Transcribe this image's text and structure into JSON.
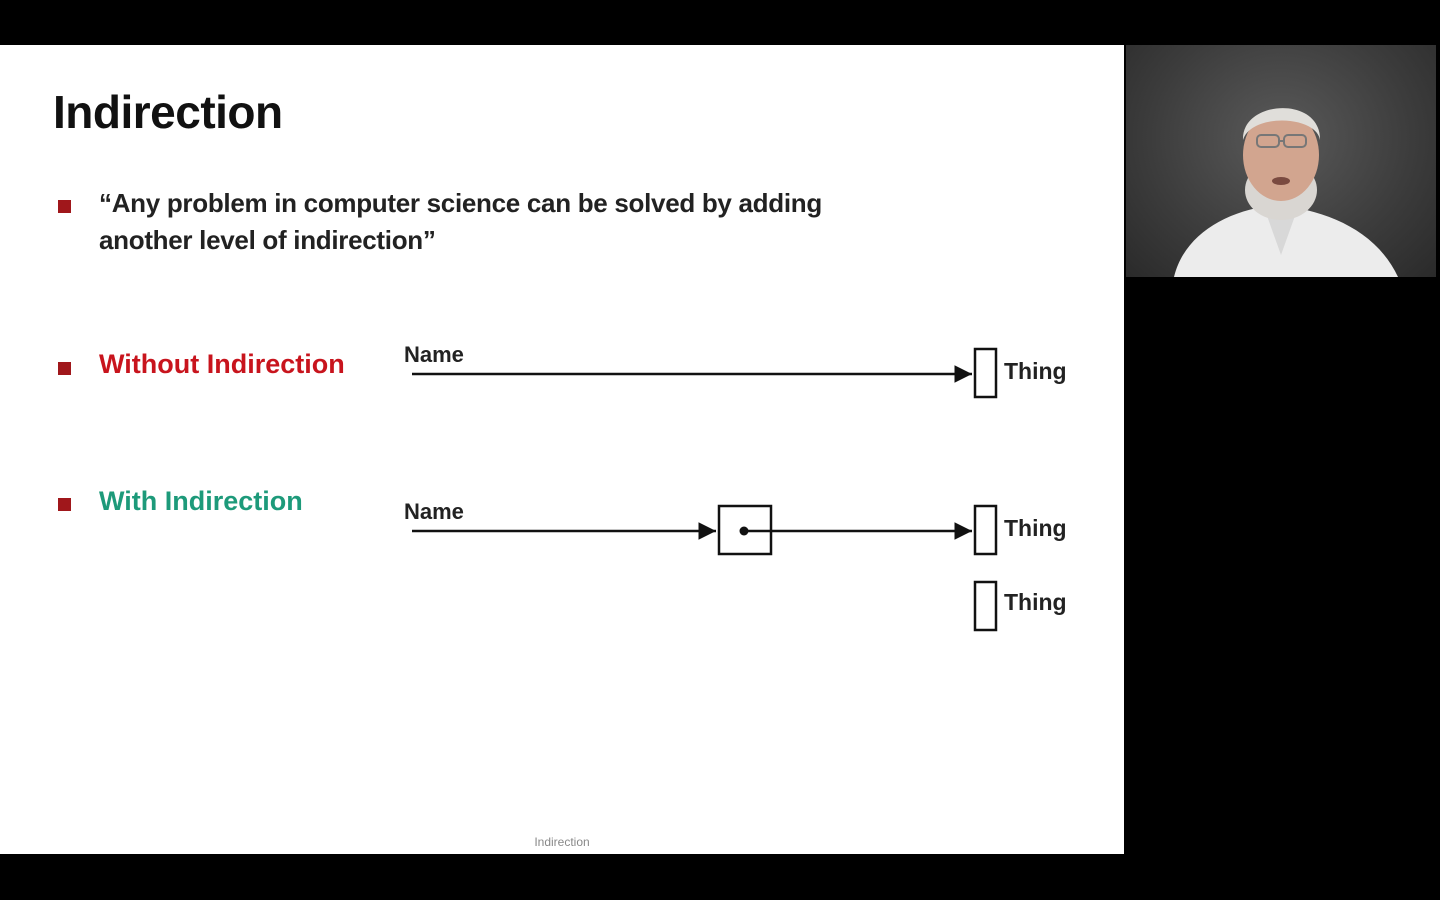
{
  "slide": {
    "title": "Indirection",
    "quote": "“Any problem in computer science can be solved by adding another level of indirection”",
    "without_label": "Without Indirection",
    "with_label": "With Indirection",
    "footer": "Indirection"
  },
  "diagram": {
    "without": {
      "name_label": "Name",
      "thing_label": "Thing"
    },
    "with": {
      "name_label": "Name",
      "thing_label_1": "Thing",
      "thing_label_2": "Thing"
    }
  },
  "colors": {
    "bullet": "#a0171b",
    "without_label": "#c8141d",
    "with_label": "#1d9a7a"
  },
  "webcam": {
    "subject": "presenter-video"
  }
}
